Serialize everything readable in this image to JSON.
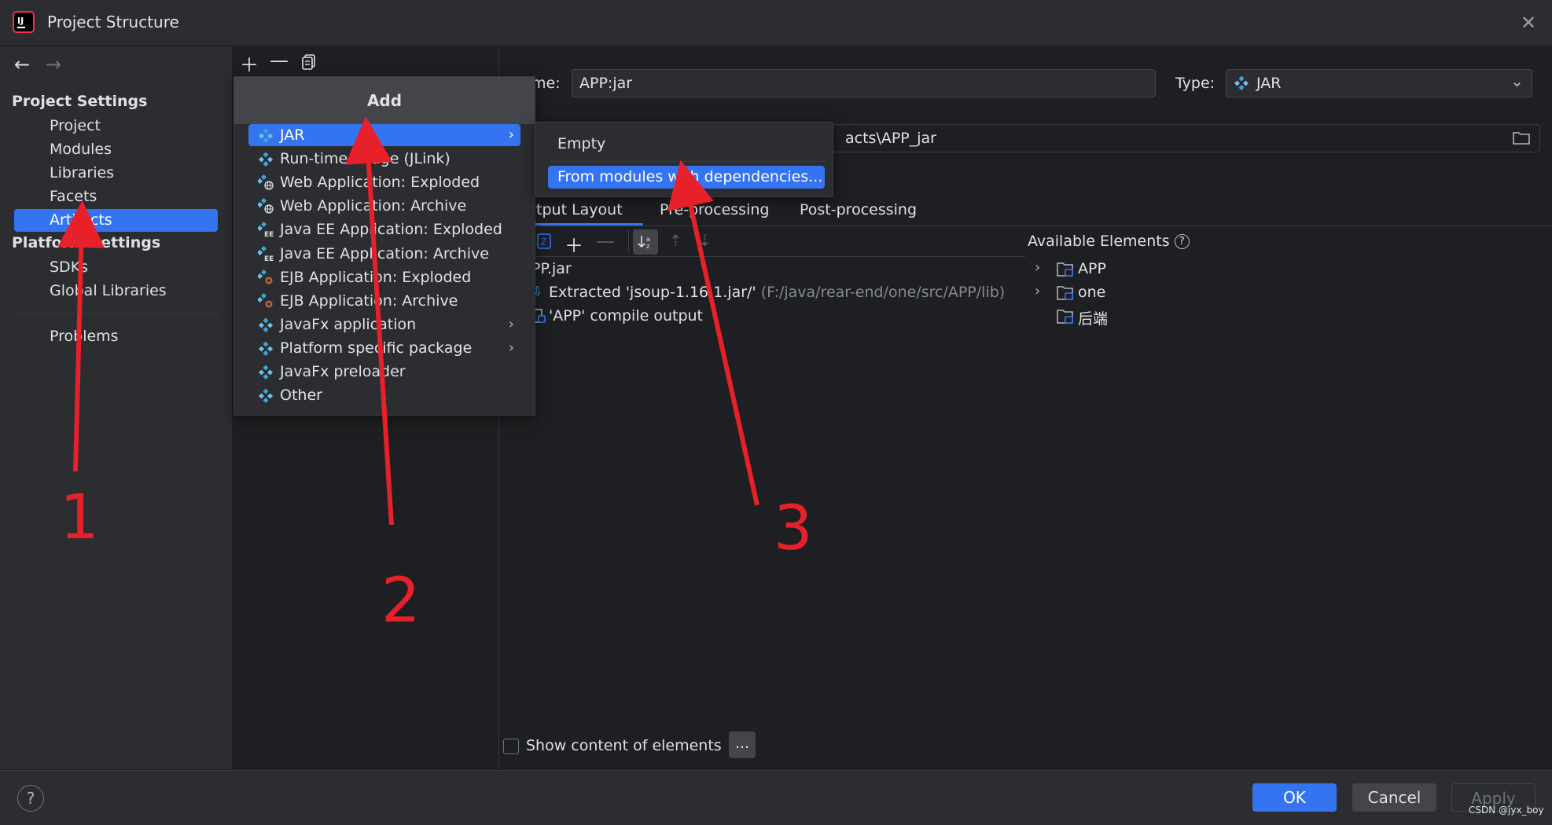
{
  "window": {
    "title": "Project Structure"
  },
  "sidebar": {
    "project_settings": "Project Settings",
    "items": [
      "Project",
      "Modules",
      "Libraries",
      "Facets",
      "Artifacts"
    ],
    "platform_settings": "Platform Settings",
    "platform_items": [
      "SDKs",
      "Global Libraries"
    ],
    "problems": "Problems"
  },
  "artifact": {
    "name_label": "me:",
    "name_value": "APP:jar",
    "type_label": "Type:",
    "type_value": "JAR",
    "output_dir_value": "acts\\APP_jar"
  },
  "tabs": [
    "utput Layout",
    "Pre-processing",
    "Post-processing"
  ],
  "layout_tree": [
    {
      "label": "PP.jar",
      "extra": ""
    },
    {
      "label": "Extracted 'jsoup-1.16.1.jar/'",
      "extra": "(F:/java/rear-end/one/src/APP/lib)"
    },
    {
      "label": "'APP' compile output",
      "extra": ""
    }
  ],
  "available": {
    "label": "Available Elements",
    "items": [
      "APP",
      "one",
      "后端"
    ]
  },
  "show_content_label": "Show content of elements",
  "ellipsis_label": "...",
  "add_menu": {
    "header": "Add",
    "items": [
      {
        "label": "JAR",
        "submenu": true,
        "icon": "jar-icon"
      },
      {
        "label": "Run-time image (JLink)",
        "submenu": false,
        "icon": "jar-icon"
      },
      {
        "label": "Web Application: Exploded",
        "submenu": false,
        "icon": "web-icon"
      },
      {
        "label": "Web Application: Archive",
        "submenu": false,
        "icon": "web-icon"
      },
      {
        "label": "Java EE Application: Exploded",
        "submenu": false,
        "icon": "javaee-icon"
      },
      {
        "label": "Java EE Application: Archive",
        "submenu": false,
        "icon": "javaee-icon"
      },
      {
        "label": "EJB Application: Exploded",
        "submenu": false,
        "icon": "ejb-icon"
      },
      {
        "label": "EJB Application: Archive",
        "submenu": false,
        "icon": "ejb-icon"
      },
      {
        "label": "JavaFx application",
        "submenu": true,
        "icon": "jar-icon"
      },
      {
        "label": "Platform specific package",
        "submenu": true,
        "icon": "jar-icon"
      },
      {
        "label": "JavaFx preloader",
        "submenu": false,
        "icon": "jar-icon"
      },
      {
        "label": "Other",
        "submenu": false,
        "icon": "jar-icon"
      }
    ]
  },
  "jar_submenu": {
    "items": [
      "Empty",
      "From modules with dependencies..."
    ]
  },
  "buttons": {
    "ok": "OK",
    "cancel": "Cancel",
    "apply": "Apply",
    "help": "?"
  },
  "annotations": [
    "1",
    "2",
    "3"
  ],
  "watermark": "CSDN @jyx_boy",
  "colors": {
    "accent": "#3574f0",
    "annotation": "#e8202a",
    "background": "#1e1f22",
    "panel": "#2b2d30"
  }
}
